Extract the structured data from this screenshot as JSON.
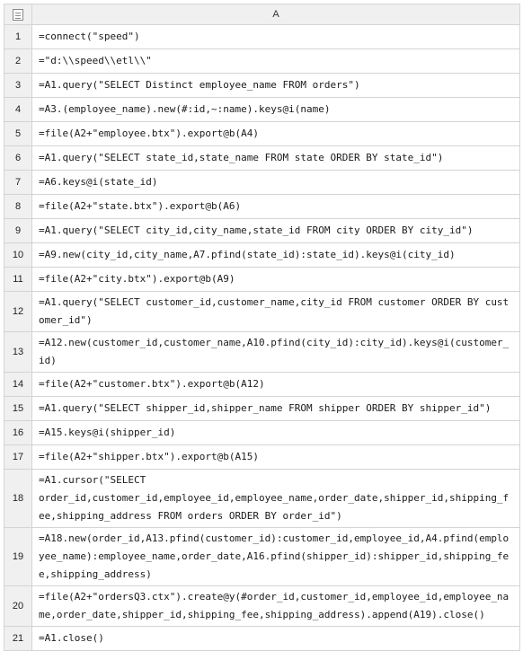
{
  "sheet": {
    "column_header": "A",
    "rows": [
      {
        "num": "1",
        "code": "=connect(\"speed\")"
      },
      {
        "num": "2",
        "code": "=\"d:\\\\speed\\\\etl\\\\\""
      },
      {
        "num": "3",
        "code": "=A1.query(\"SELECT Distinct employee_name FROM orders\")"
      },
      {
        "num": "4",
        "code": "=A3.(employee_name).new(#:id,~:name).keys@i(name)"
      },
      {
        "num": "5",
        "code": "=file(A2+\"employee.btx\").export@b(A4)"
      },
      {
        "num": "6",
        "code": "=A1.query(\"SELECT state_id,state_name FROM state ORDER BY state_id\")"
      },
      {
        "num": "7",
        "code": "=A6.keys@i(state_id)"
      },
      {
        "num": "8",
        "code": "=file(A2+\"state.btx\").export@b(A6)"
      },
      {
        "num": "9",
        "code": "=A1.query(\"SELECT city_id,city_name,state_id FROM city ORDER BY city_id\")"
      },
      {
        "num": "10",
        "code": "=A9.new(city_id,city_name,A7.pfind(state_id):state_id).keys@i(city_id)"
      },
      {
        "num": "11",
        "code": "=file(A2+\"city.btx\").export@b(A9)"
      },
      {
        "num": "12",
        "code": "=A1.query(\"SELECT customer_id,customer_name,city_id FROM customer ORDER BY customer_id\")"
      },
      {
        "num": "13",
        "code": "=A12.new(customer_id,customer_name,A10.pfind(city_id):city_id).keys@i(customer_id)"
      },
      {
        "num": "14",
        "code": "=file(A2+\"customer.btx\").export@b(A12)"
      },
      {
        "num": "15",
        "code": "=A1.query(\"SELECT shipper_id,shipper_name FROM shipper ORDER BY shipper_id\")"
      },
      {
        "num": "16",
        "code": "=A15.keys@i(shipper_id)"
      },
      {
        "num": "17",
        "code": "=file(A2+\"shipper.btx\").export@b(A15)"
      },
      {
        "num": "18",
        "code": "=A1.cursor(\"SELECT\norder_id,customer_id,employee_id,employee_name,order_date,shipper_id,shipping_fee,shipping_address FROM orders ORDER BY order_id\")"
      },
      {
        "num": "19",
        "code": "=A18.new(order_id,A13.pfind(customer_id):customer_id,employee_id,A4.pfind(employee_name):employee_name,order_date,A16.pfind(shipper_id):shipper_id,shipping_fee,shipping_address)"
      },
      {
        "num": "20",
        "code": "=file(A2+\"ordersQ3.ctx\").create@y(#order_id,customer_id,employee_id,employee_name,order_date,shipper_id,shipping_fee,shipping_address).append(A19).close()"
      },
      {
        "num": "21",
        "code": "=A1.close()"
      }
    ]
  }
}
